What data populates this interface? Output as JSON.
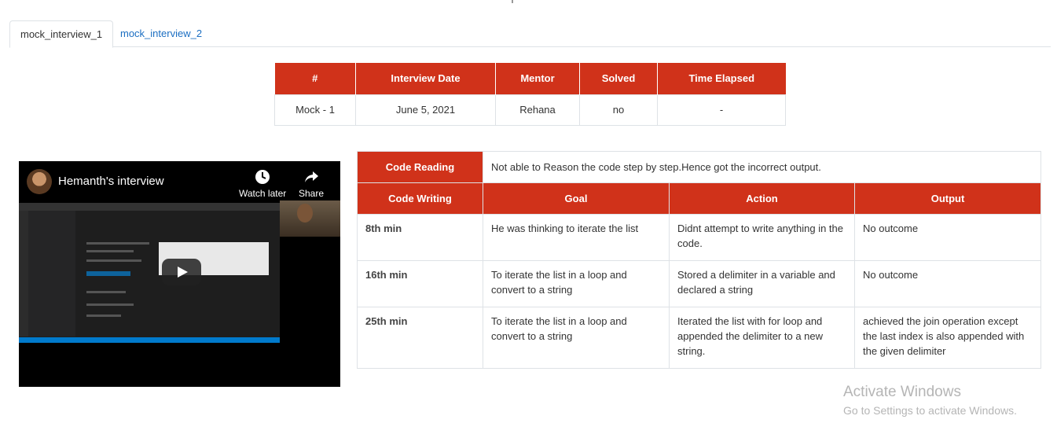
{
  "tabs": [
    {
      "label": "mock_interview_1",
      "active": true
    },
    {
      "label": "mock_interview_2",
      "active": false
    }
  ],
  "summary": {
    "headers": [
      "#",
      "Interview Date",
      "Mentor",
      "Solved",
      "Time Elapsed"
    ],
    "row": [
      "Mock - 1",
      "June 5, 2021",
      "Rehana",
      "no",
      "-"
    ]
  },
  "video": {
    "title": "Hemanth's interview",
    "watch_later": "Watch later",
    "share": "Share",
    "icons": {
      "watch_later": "clock-icon",
      "share": "share-arrow-icon",
      "play": "play-icon"
    }
  },
  "details": {
    "code_reading_label": "Code Reading",
    "code_reading_text": "Not able to Reason the code step by step.Hence got the incorrect output.",
    "headers": [
      "Code Writing",
      "Goal",
      "Action",
      "Output"
    ],
    "rows": [
      {
        "time": "8th min",
        "goal": "He was thinking to iterate the list",
        "action": "Didnt attempt to write anything in the code.",
        "output": "No outcome"
      },
      {
        "time": "16th min",
        "goal": "To iterate the list in a loop and convert to a string",
        "action": "Stored a delimiter in a variable and declared a string",
        "output": "No outcome"
      },
      {
        "time": "25th min",
        "goal": "To iterate the list in a loop and convert to a string",
        "action": "Iterated the list with for loop and appended the delimiter to a new string.",
        "output": "achieved the join operation except the last index is also appended with the given delimiter"
      }
    ]
  },
  "watermark": {
    "line1": "Activate Windows",
    "line2": "Go to Settings to activate Windows."
  },
  "colors": {
    "accent": "#d0321a",
    "link": "#1b6ec2"
  }
}
